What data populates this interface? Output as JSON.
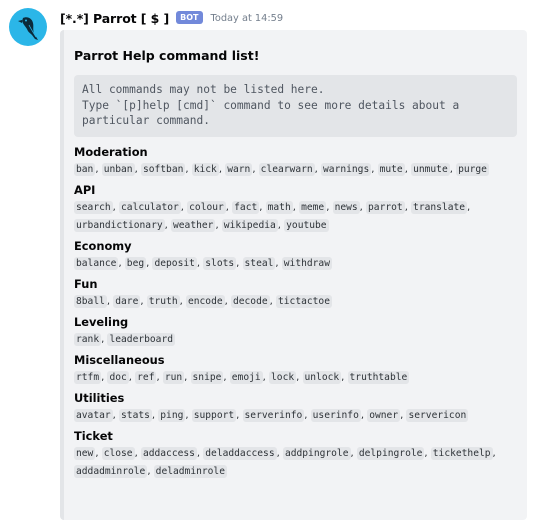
{
  "message": {
    "username": "[*.*] Parrot [ $ ]",
    "bot_tag": "BOT",
    "timestamp": "Today at 14:59",
    "avatar_icon": "parrot-icon",
    "colors": {
      "avatar_bg": "#2bb6e8",
      "bot_tag": "#7289da",
      "embed_bg": "#f2f3f5"
    }
  },
  "embed": {
    "title": "Parrot Help command list!",
    "code_lines": [
      "All commands may not be listed here.",
      "Type `[p]help [cmd]` command to see more details about a",
      "particular command."
    ],
    "sections": [
      {
        "title": "Moderation",
        "commands": [
          "ban",
          "unban",
          "softban",
          "kick",
          "warn",
          "clearwarn",
          "warnings",
          "mute",
          "unmute",
          "purge"
        ]
      },
      {
        "title": "API",
        "commands": [
          "search",
          "calculator",
          "colour",
          "fact",
          "math",
          "meme",
          "news",
          "parrot",
          "translate",
          "urbandictionary",
          "weather",
          "wikipedia",
          "youtube"
        ]
      },
      {
        "title": "Economy",
        "commands": [
          "balance",
          "beg",
          "deposit",
          "slots",
          "steal",
          "withdraw"
        ]
      },
      {
        "title": "Fun",
        "commands": [
          "8ball",
          "dare",
          "truth",
          "encode",
          "decode",
          "tictactoe"
        ]
      },
      {
        "title": "Leveling",
        "commands": [
          "rank",
          "leaderboard"
        ]
      },
      {
        "title": "Miscellaneous",
        "commands": [
          "rtfm",
          "doc",
          "ref",
          "run",
          "snipe",
          "emoji",
          "lock",
          "unlock",
          "truthtable"
        ]
      },
      {
        "title": "Utilities",
        "commands": [
          "avatar",
          "stats",
          "ping",
          "support",
          "serverinfo",
          "userinfo",
          "owner",
          "servericon"
        ]
      },
      {
        "title": "Ticket",
        "commands": [
          "new",
          "close",
          "addaccess",
          "deladdaccess",
          "addpingrole",
          "delpingrole",
          "tickethelp",
          "addadminrole",
          "deladminrole"
        ]
      }
    ]
  }
}
